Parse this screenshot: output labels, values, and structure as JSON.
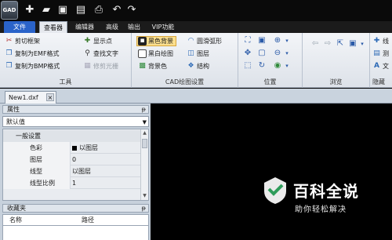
{
  "app": {
    "logo_text": "GAD"
  },
  "ribbon_tabs": {
    "file": "文件",
    "viewer": "查看器",
    "editor": "编辑器",
    "advanced": "高级",
    "output": "输出",
    "vip": "VIP功能"
  },
  "groups": {
    "tools": {
      "label": "工具",
      "items": [
        "剪切框架",
        "复制为EMF格式",
        "复制为BMP格式",
        "显示点",
        "查找文字",
        "修剪光栅"
      ]
    },
    "cad_settings": {
      "label": "CAD绘图设置",
      "items": [
        "黑色背景",
        "黑白绘图",
        "背景色",
        "圆滑弧形",
        "图层",
        "结构"
      ]
    },
    "position": {
      "label": "位置"
    },
    "browse": {
      "label": "浏览"
    },
    "hide": {
      "label": "隐藏",
      "items": [
        "线",
        "测",
        "文"
      ]
    }
  },
  "document": {
    "tab_name": "New1.dxf",
    "close_glyph": "×"
  },
  "properties_panel": {
    "title": "属性",
    "pin": "ᵽ",
    "selector_value": "默认值",
    "category": "一般设置",
    "rows": [
      {
        "key": "色彩",
        "value": "以图层"
      },
      {
        "key": "图层",
        "value": "0"
      },
      {
        "key": "线型",
        "value": "以图层"
      },
      {
        "key": "线型比例",
        "value": "1"
      }
    ]
  },
  "favorites_panel": {
    "title": "收藏夹",
    "pin": "ᵽ",
    "col_name": "名称",
    "col_path": "路径"
  },
  "watermark": {
    "title": "百科全说",
    "subtitle": "助你轻松解决"
  },
  "colors": {
    "ribbon_bg": "#e6e9ee",
    "file_tab": "#2a63c9",
    "checked": "#fbdf8e",
    "canvas": "#000000"
  }
}
